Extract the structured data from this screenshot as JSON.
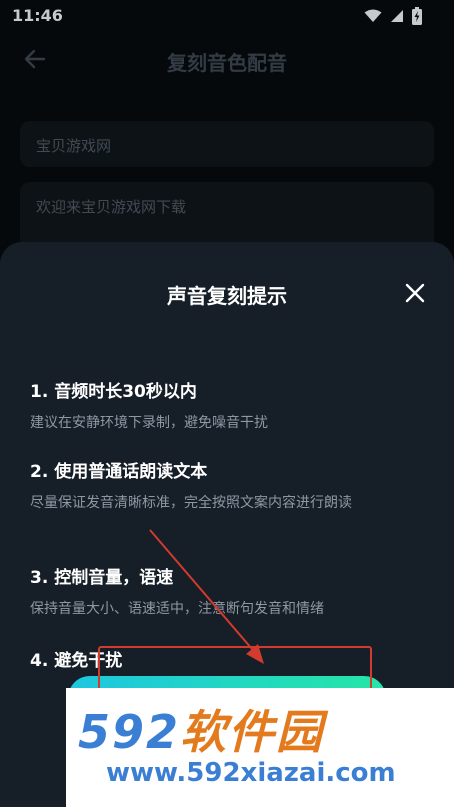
{
  "status_bar": {
    "time": "11:46"
  },
  "nav": {
    "title": "复刻音色配音"
  },
  "form": {
    "name_value": "宝贝游戏网",
    "text_value": "欢迎来宝贝游戏网下载"
  },
  "dialog": {
    "title": "声音复刻提示",
    "tips": [
      {
        "heading": "1. 音频时长30秒以内",
        "detail": "建议在安静环境下录制，避免噪音干扰"
      },
      {
        "heading": "2. 使用普通话朗读文本",
        "detail": "尽量保证发音清晰标准，完全按照文案内容进行朗读"
      },
      {
        "heading": "3. 控制音量，语速",
        "detail": "保持音量大小、语速适中，注意断句发音和情绪"
      },
      {
        "heading": "4. 避免干扰",
        "detail": ""
      }
    ]
  },
  "watermark": {
    "logo_number": "592",
    "logo_text": "软件园",
    "url": "www.592xiazai.com"
  },
  "colors": {
    "background": "#070b0f",
    "sheet": "#161e27",
    "button_gradient_start": "#1ec6e0",
    "button_gradient_end": "#25e6a6",
    "annotation_red": "#d23b2e"
  }
}
